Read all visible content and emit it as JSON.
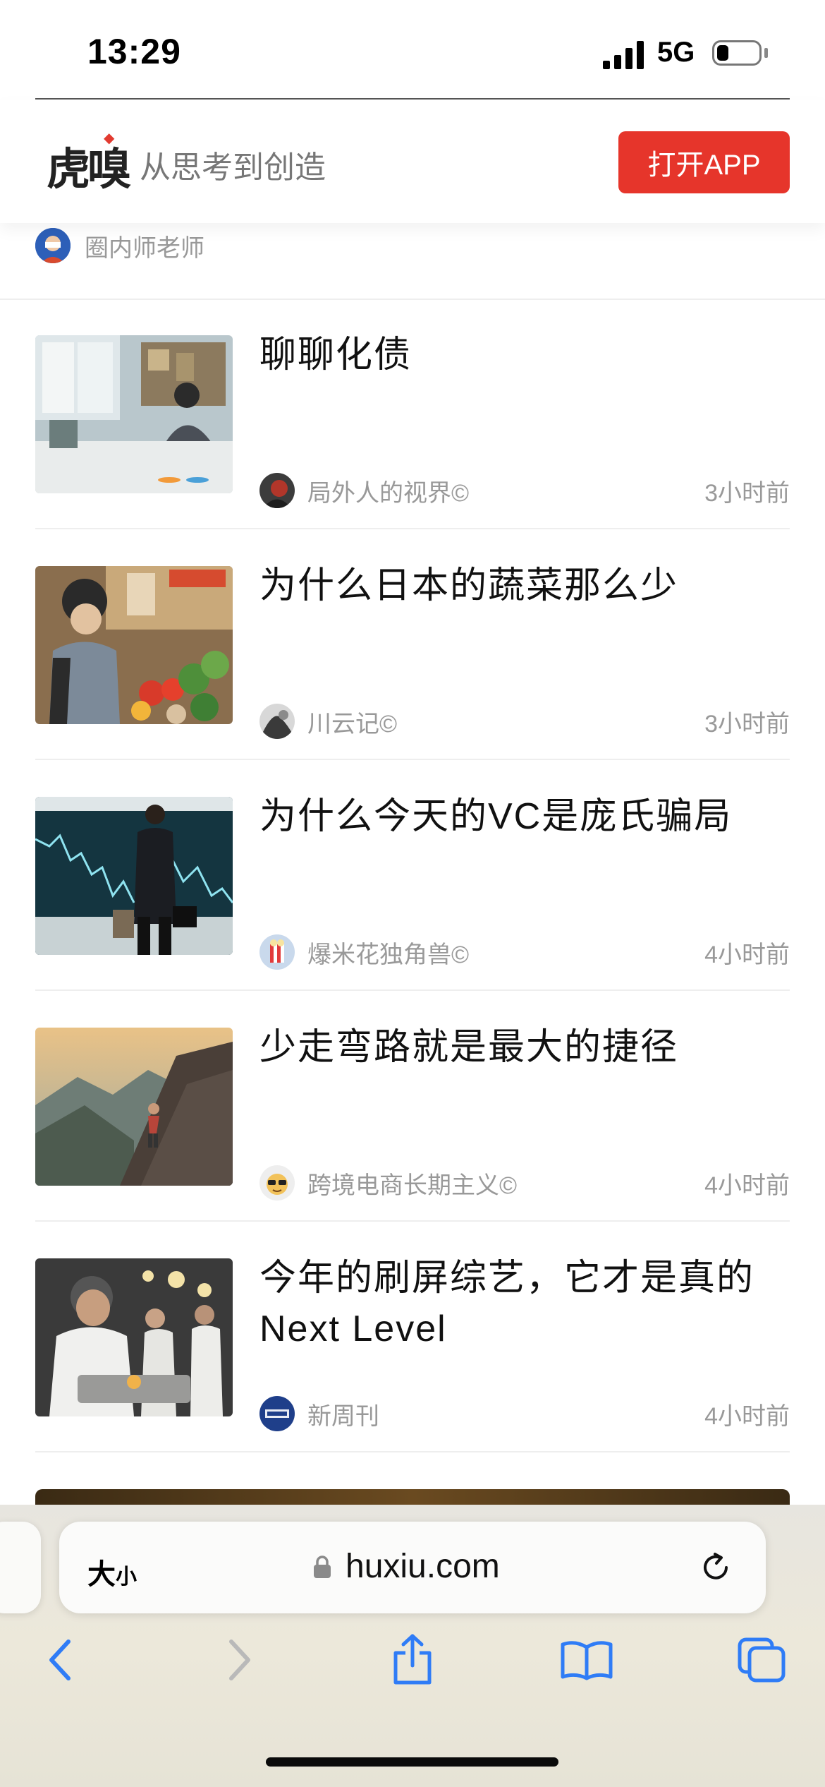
{
  "status_bar": {
    "time": "13:29",
    "network": "5G"
  },
  "site_header": {
    "logo": "虎嗅",
    "slogan": "从思考到创造",
    "open_app_label": "打开APP"
  },
  "previous_item": {
    "author": "圈内师老师"
  },
  "articles": [
    {
      "title": "聊聊化债",
      "author": "局外人的视界©",
      "time": "3小时前"
    },
    {
      "title": "为什么日本的蔬菜那么少",
      "author": "川云记©",
      "time": "3小时前"
    },
    {
      "title": "为什么今天的VC是庞氏骗局",
      "author": "爆米花独角兽©",
      "time": "4小时前"
    },
    {
      "title": "少走弯路就是最大的捷径",
      "author": "跨境电商长期主义©",
      "time": "4小时前"
    },
    {
      "title": "今年的刷屏综艺，它才是真的Next Level",
      "author": "新周刊",
      "time": "4小时前"
    }
  ],
  "browser": {
    "text_size_label": "大",
    "text_size_small": "小",
    "url": "huxiu.com"
  },
  "colors": {
    "brand_red": "#e6352b",
    "toolbar_blue": "#2f7cf6"
  }
}
